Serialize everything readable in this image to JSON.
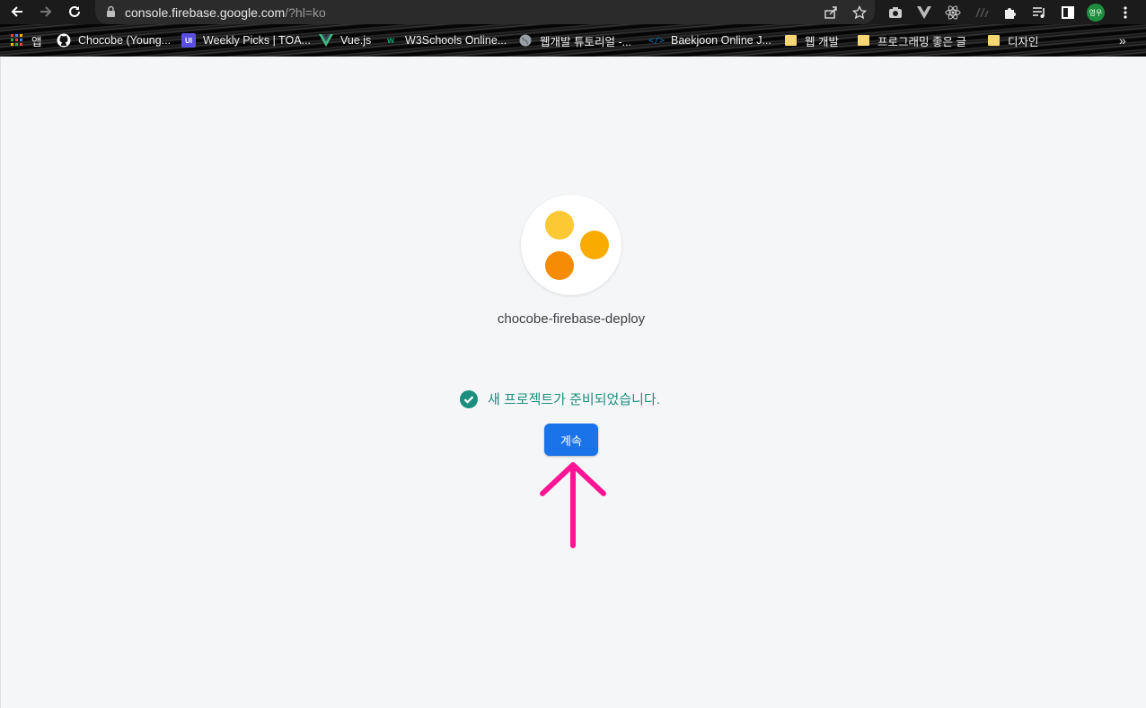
{
  "browser": {
    "url_host": "console.firebase.google.com",
    "url_path": "/?hl=ko",
    "profile_initials": "영우",
    "icons": [
      "back-icon",
      "forward-icon",
      "reload-icon",
      "lock-icon",
      "share-icon",
      "star-icon",
      "camera-icon",
      "vue-devtools-icon",
      "react-icon",
      "extension-icon",
      "puzzle-icon",
      "media-icon",
      "sidepanel-icon",
      "menu-icon"
    ]
  },
  "bookmarks": {
    "apps_label": "앱",
    "items": [
      {
        "label": "Chocobe (Young...",
        "icon": "github-icon"
      },
      {
        "label": "Weekly Picks | TOA...",
        "icon": "toast-ui-icon"
      },
      {
        "label": "Vue.js",
        "icon": "vue-icon"
      },
      {
        "label": "W3Schools Online...",
        "icon": "w3schools-icon"
      },
      {
        "label": "웹개발 튜토리얼 -...",
        "icon": "globe-icon"
      },
      {
        "label": "Baekjoon Online J...",
        "icon": "code-icon"
      },
      {
        "label": "웹 개발",
        "icon": "folder-icon"
      },
      {
        "label": "프로그래밍 좋은 글",
        "icon": "folder-icon"
      },
      {
        "label": "디자인",
        "icon": "folder-icon"
      }
    ],
    "more_label": "»"
  },
  "main": {
    "project_name": "chocobe-firebase-deploy",
    "ready_message": "새 프로젝트가 준비되었습니다.",
    "continue_label": "계속"
  },
  "colors": {
    "accent": "#1a73e8",
    "success": "#1b8f7d",
    "annotation_arrow": "#ff1493",
    "logo_dots": [
      "#fcc934",
      "#f9ab00",
      "#f68b04"
    ]
  }
}
